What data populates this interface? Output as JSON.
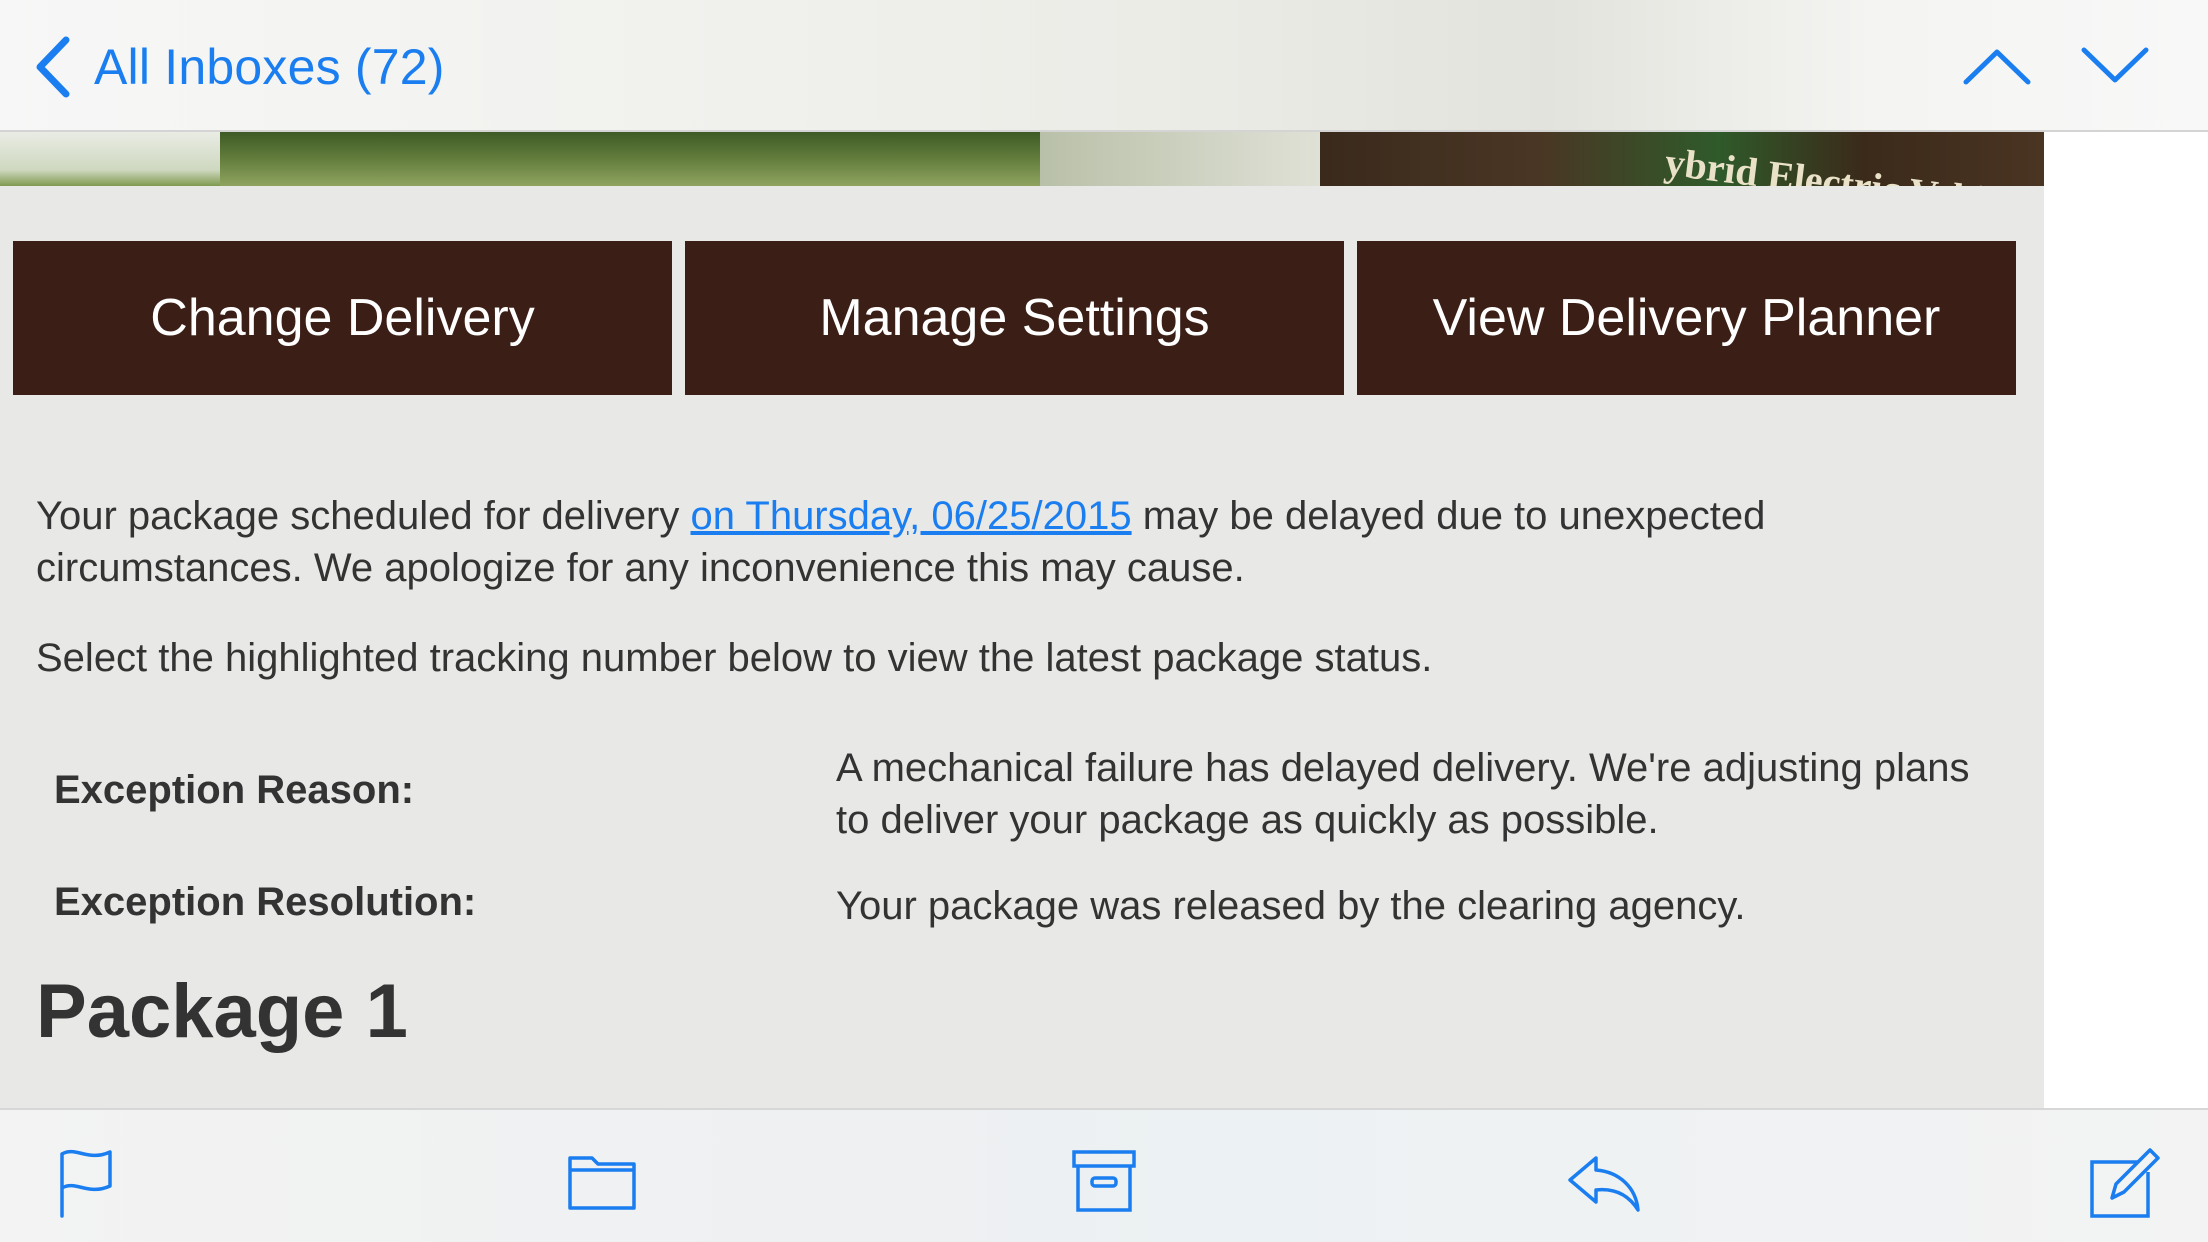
{
  "nav": {
    "back_label": "All Inboxes (72)",
    "back_icon": "chevron-left-icon",
    "prev_icon": "chevron-up-icon",
    "next_icon": "chevron-down-icon",
    "accent_color": "#1a7ef0"
  },
  "banner": {
    "caption": "ybrid Electric Vehicle"
  },
  "actions": {
    "change_delivery": "Change Delivery",
    "manage_settings": "Manage Settings",
    "view_planner": "View Delivery Planner",
    "button_color": "#3b1f16"
  },
  "message": {
    "intro_before": "Your package scheduled for delivery ",
    "intro_link": "on Thursday, 06/25/2015",
    "intro_after": " may be delayed due to unexpected circumstances. We apologize for any inconvenience this may cause.",
    "instruction": "Select the highlighted tracking number below to view the latest package status."
  },
  "exceptions": [
    {
      "label": "Exception Reason:",
      "value": "A mechanical failure has delayed delivery. We're adjusting plans to deliver your package as quickly as possible."
    },
    {
      "label": "Exception Resolution:",
      "value": "Your package was released by the clearing agency."
    }
  ],
  "package_heading": "Package 1",
  "toolbar": {
    "icons": [
      "flag-icon",
      "folder-icon",
      "archive-icon",
      "reply-icon",
      "compose-icon"
    ]
  }
}
